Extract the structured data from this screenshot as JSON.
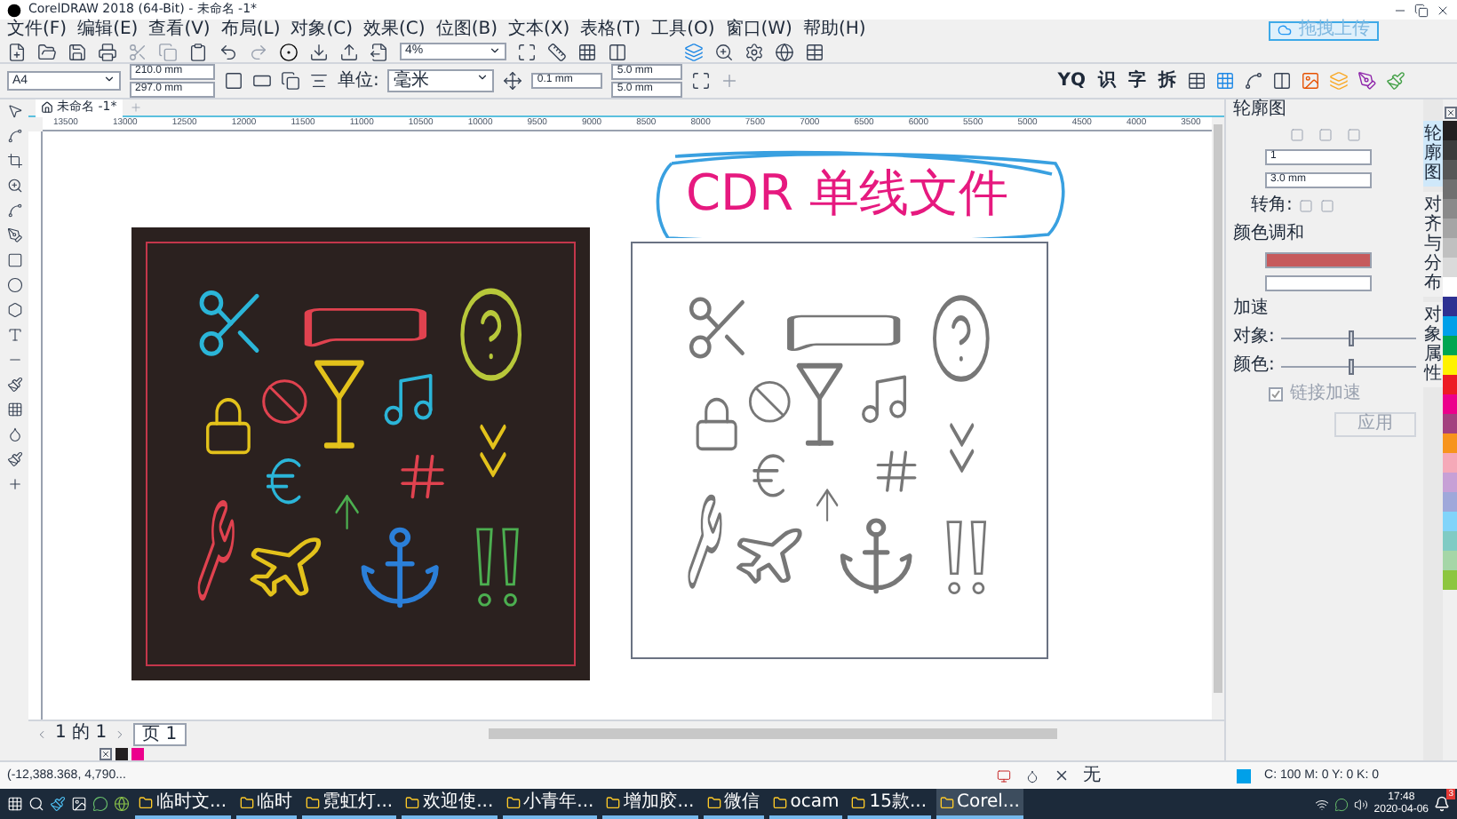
{
  "window": {
    "title": "CorelDRAW 2018 (64-Bit) - 未命名 -1*",
    "upload_button": "拖拽上传"
  },
  "menu": [
    "文件(F)",
    "编辑(E)",
    "查看(V)",
    "布局(L)",
    "对象(C)",
    "效果(C)",
    "位图(B)",
    "文本(X)",
    "表格(T)",
    "工具(O)",
    "窗口(W)",
    "帮助(H)"
  ],
  "zoom_level": "4%",
  "property_bar": {
    "page_size": "A4",
    "width": "210.0 mm",
    "height": "297.0 mm",
    "units_label": "单位:",
    "units": "毫米",
    "nudge": "0.1 mm",
    "duplicate_x": "5.0 mm",
    "duplicate_y": "5.0 mm"
  },
  "macro_buttons": [
    "YQ",
    "识",
    "字",
    "拆"
  ],
  "document_tab": {
    "label": "未命名 -1*",
    "selected": true
  },
  "ruler_labels": [
    "13500",
    "13000",
    "12500",
    "12000",
    "11500",
    "11000",
    "10500",
    "10000",
    "9500",
    "9000",
    "8500",
    "8000",
    "7500",
    "7000",
    "6500",
    "6000",
    "5500",
    "5000",
    "4500",
    "4000",
    "3500"
  ],
  "headline": "CDR 单线文件",
  "contour_panel": {
    "title": "轮廓图",
    "steps": "1",
    "offset": "3.0 mm",
    "corners_label": "转角:",
    "color_blend_label": "颜色调和",
    "color_fields": [
      {
        "color": "#c65a5c"
      },
      {
        "color": "#ffffff"
      }
    ],
    "acceleration_label": "加速",
    "sliders": [
      {
        "label": "对象:",
        "level": 0.5
      },
      {
        "label": "颜色:",
        "level": 0.5
      }
    ],
    "link_label": "链接加速",
    "link_checked": true,
    "apply_button": "应用"
  },
  "docker_tabs": [
    {
      "label": "轮廓图",
      "selected": true
    },
    {
      "label": "对齐与分布",
      "selected": false
    },
    {
      "label": "对象属性",
      "selected": false
    }
  ],
  "palette": [
    {
      "color": "#231f20"
    },
    {
      "color": "#3c3c3c"
    },
    {
      "color": "#575757"
    },
    {
      "color": "#707070"
    },
    {
      "color": "#8a8a8a"
    },
    {
      "color": "#a5a5a5"
    },
    {
      "color": "#c0c0c0"
    },
    {
      "color": "#dadada"
    },
    {
      "color": "#ffffff"
    },
    {
      "color": "#2e3192"
    },
    {
      "color": "#00a0e9"
    },
    {
      "color": "#00a651"
    },
    {
      "color": "#fff200"
    },
    {
      "color": "#ed1c24"
    },
    {
      "color": "#ec008c"
    },
    {
      "color": "#a3417f"
    },
    {
      "color": "#f7941d"
    },
    {
      "color": "#f5a9b8"
    },
    {
      "color": "#c7a0d6"
    },
    {
      "color": "#9fa8da"
    },
    {
      "color": "#81d4fa"
    },
    {
      "color": "#80cbc4"
    },
    {
      "color": "#a5d6a7"
    },
    {
      "color": "#8dc63f"
    }
  ],
  "page_nav": {
    "position": "1 的 1",
    "page_tab": "页 1"
  },
  "document_palette": [
    {
      "color": "#231f20"
    },
    {
      "color": "#ec008c"
    }
  ],
  "status": {
    "coordinates": "(-12,388.368, 4,790...",
    "fill": "无",
    "outline_swatch": {
      "color": "#00a0e9"
    },
    "outline": "C: 100 M: 0 Y: 0 K: 0"
  },
  "taskbar": {
    "items": [
      {
        "label": "临时文...",
        "selected": false
      },
      {
        "label": "临时",
        "selected": false
      },
      {
        "label": "霓虹灯...",
        "selected": false
      },
      {
        "label": "欢迎使...",
        "selected": false
      },
      {
        "label": "小青年...",
        "selected": false
      },
      {
        "label": "增加胶...",
        "selected": false
      },
      {
        "label": "微信",
        "selected": false
      },
      {
        "label": "ocam",
        "selected": false
      },
      {
        "label": "15款...",
        "selected": false
      },
      {
        "label": "Corel...",
        "selected": true
      }
    ],
    "time": "17:48",
    "date": "2020-04-06",
    "notifications": "3"
  }
}
